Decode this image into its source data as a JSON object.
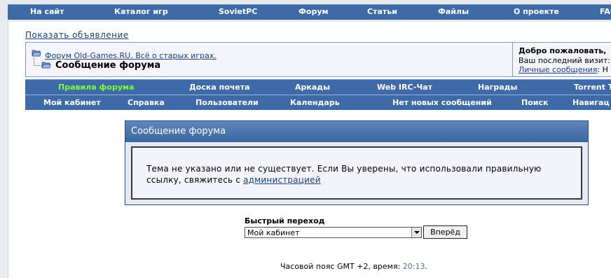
{
  "topnav": {
    "items": [
      "На сайт",
      "Каталог игр",
      "SovietPC",
      "Форум",
      "Статьи",
      "Файлы",
      "О проекте",
      "FAQ"
    ]
  },
  "ad_link": "Показать объявление",
  "breadcrumb": {
    "forum_link": "Форум Old-Games.RU. Всё о старых играх.",
    "current": "Сообщение форума"
  },
  "welcome": {
    "greeting": "Добро пожаловать,",
    "last_visit": "Ваш последний визит:",
    "pm_link": "Личные сообщения",
    "pm_suffix": ": Н"
  },
  "menu1": {
    "items": [
      "Правила форума",
      "Доска почета",
      "Аркады",
      "Web IRC-Чат",
      "Награды",
      "Torrent T"
    ]
  },
  "menu2": {
    "items": [
      "Мой кабинет",
      "Справка",
      "Пользователи",
      "Календарь",
      "Нет новых сообщений",
      "Поиск",
      "Навигац"
    ]
  },
  "message": {
    "title": "Сообщение форума",
    "text": "Тема не указано или не существует. Если Вы уверены, что использовали правильную ссылку, свяжитесь с ",
    "admin_link": "администрацией"
  },
  "jump": {
    "label": "Быстрый переход",
    "selected": "Мой кабинет",
    "button": "Вперёд"
  },
  "footer": {
    "timezone_prefix": "Часовой пояс GMT +2, время: ",
    "time": "20:13",
    "suffix": "."
  },
  "colors": {
    "nav_bar": "#3e6aa8",
    "accent_green": "#7cfc3a",
    "link": "#1c3f7a"
  }
}
